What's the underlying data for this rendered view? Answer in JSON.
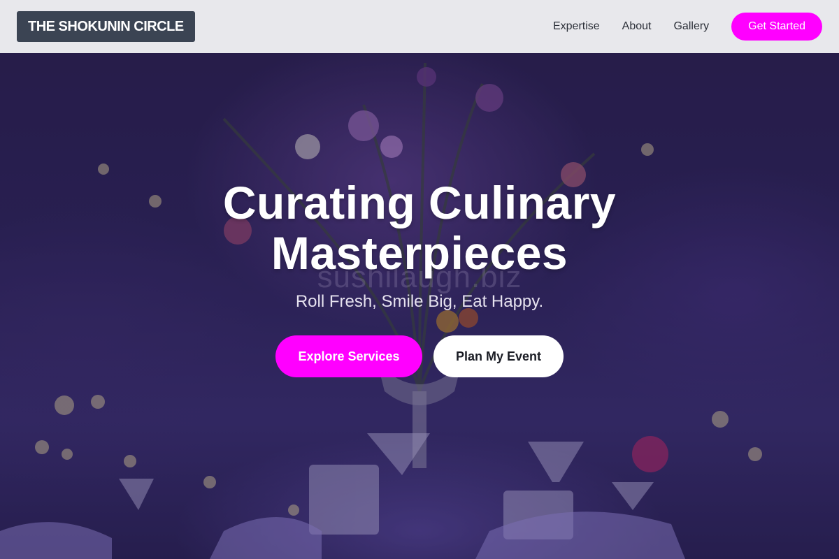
{
  "header": {
    "brand": "THE SHOKUNIN CIRCLE",
    "nav": [
      {
        "label": "Expertise"
      },
      {
        "label": "About"
      },
      {
        "label": "Gallery"
      }
    ],
    "cta_label": "Get Started"
  },
  "hero": {
    "headline_line1": "Curating Culinary",
    "headline_line2": "Masterpieces",
    "watermark": "sushilaugh.biz",
    "tagline": "Roll Fresh, Smile Big, Eat Happy.",
    "primary_button": "Explore Services",
    "secondary_button": "Plan My Event"
  },
  "colors": {
    "accent": "#ff00ff",
    "header_bg": "#f0f0f2",
    "logo_bg": "#3b4453",
    "hero_overlay": "#2d2358"
  }
}
